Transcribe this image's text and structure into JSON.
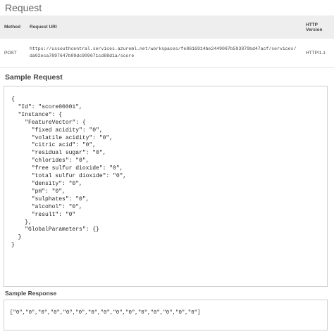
{
  "request": {
    "title": "Request",
    "headers": {
      "method": "Method",
      "uri": "Request URI",
      "version": "HTTP Version"
    },
    "row": {
      "method": "POST",
      "uri": "https://ussouthcentral.services.azureml.net/workspaces/fe8616914be2449087b593879bd47acf/services/da02eca7897647b09dc909671cd88d1a/score",
      "version": "HTTP/1.1"
    }
  },
  "sample_request": {
    "title": "Sample Request",
    "body": "{\n  \"Id\": \"score00001\",\n  \"Instance\": {\n    \"FeatureVector\": {\n      \"fixed acidity\": \"0\",\n      \"volatile acidity\": \"0\",\n      \"citric acid\": \"0\",\n      \"residual sugar\": \"0\",\n      \"chlorides\": \"0\",\n      \"free sulfur dioxide\": \"0\",\n      \"total sulfur dioxide\": \"0\",\n      \"density\": \"0\",\n      \"pH\": \"0\",\n      \"sulphates\": \"0\",\n      \"alcohol\": \"0\",\n      \"result\": \"0\"\n    },\n    \"GlobalParameters\": {}\n  }\n}"
  },
  "sample_response": {
    "title": "Sample Response",
    "body": "[\"0\",\"0\",\"0\",\"0\",\"0\",\"0\",\"0\",\"0\",\"0\",\"0\",\"0\",\"0\",\"0\",\"0\",\"0\"]"
  }
}
